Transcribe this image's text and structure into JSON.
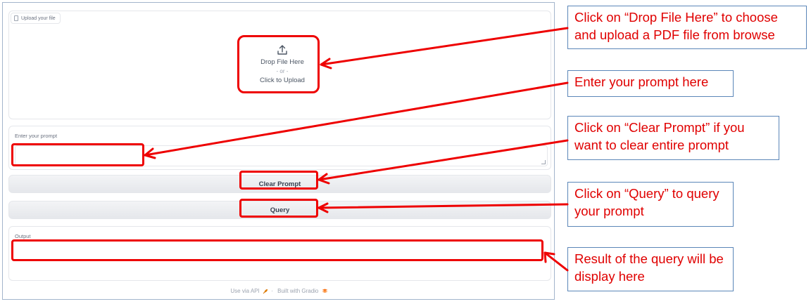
{
  "upload": {
    "tab_label": "Upload your file",
    "drop_text": "Drop File Here",
    "or_text": "- or -",
    "click_text": "Click to Upload"
  },
  "prompt": {
    "label": "Enter your prompt",
    "value": ""
  },
  "buttons": {
    "clear_label": "Clear Prompt",
    "query_label": "Query"
  },
  "output": {
    "label": "Output",
    "value": ""
  },
  "footer": {
    "api_text": "Use via API",
    "separator": "·",
    "built_text": "Built with Gradio"
  },
  "callouts": {
    "upload": "Click on “Drop File Here” to choose and upload a PDF file from browse",
    "prompt": "Enter your prompt here",
    "clear": "Click on “Clear Prompt” if you want to clear entire prompt",
    "query": "Click on “Query” to query your prompt",
    "output": "Result of the query will be display here"
  },
  "colors": {
    "annotation_red": "#e00000",
    "callout_border": "#5b86b8",
    "frame_border": "#a3b5cc"
  },
  "icons": [
    "file-icon",
    "upload-icon",
    "rocket-icon",
    "gradio-logo-icon"
  ]
}
